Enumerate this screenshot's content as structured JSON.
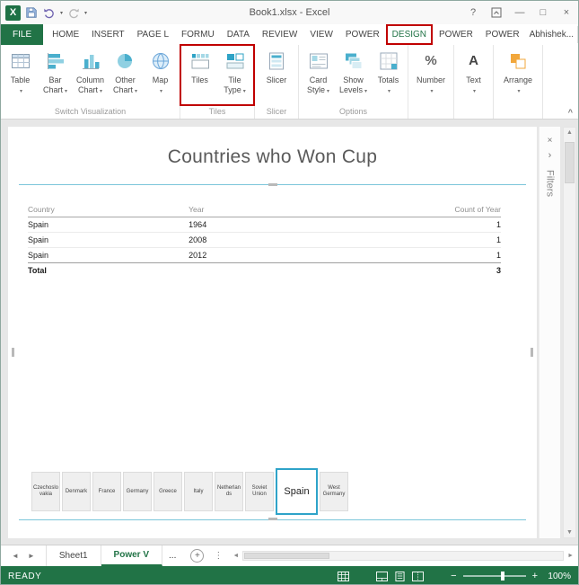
{
  "colors": {
    "excel_green": "#217346",
    "annotation_red": "#c00000",
    "selection_teal": "#7cc6da",
    "tile_selected_border": "#2ea3c9"
  },
  "icons": {
    "excel_logo": "X",
    "dropdown_caret": "▾",
    "help": "?",
    "minimize": "—",
    "maximize": "□",
    "close": "×",
    "filters_chevron": "›",
    "collapse_ribbon": "^",
    "scroll_up": "▲",
    "scroll_down": "▼",
    "scroll_left": "◄",
    "scroll_right": "►",
    "nav_left": "◄",
    "nav_right": "►",
    "new_sheet": "+",
    "tab_menu": "⋮",
    "number_glyph": "%",
    "text_glyph": "A",
    "zoom_minus": "−",
    "zoom_plus": "+"
  },
  "titlebar": {
    "title": "Book1.xlsx - Excel"
  },
  "ribbon": {
    "file_tab": "FILE",
    "tabs": [
      "HOME",
      "INSERT",
      "PAGE L",
      "FORMU",
      "DATA",
      "REVIEW",
      "VIEW",
      "POWER",
      "DESIGN",
      "POWER",
      "POWER"
    ],
    "active_tab": "DESIGN",
    "user_name": "Abhishek...",
    "groups": [
      {
        "label": "Switch Visualization",
        "buttons": [
          {
            "line1": "Table",
            "line2": ""
          },
          {
            "line1": "Bar",
            "line2": "Chart"
          },
          {
            "line1": "Column",
            "line2": "Chart"
          },
          {
            "line1": "Other",
            "line2": "Chart"
          },
          {
            "line1": "Map",
            "line2": ""
          }
        ]
      },
      {
        "label": "Tiles",
        "buttons": [
          {
            "line1": "Tiles",
            "line2": ""
          },
          {
            "line1": "Tile",
            "line2": "Type"
          }
        ]
      },
      {
        "label": "Slicer",
        "buttons": [
          {
            "line1": "Slicer",
            "line2": ""
          }
        ]
      },
      {
        "label": "Options",
        "buttons": [
          {
            "line1": "Card",
            "line2": "Style"
          },
          {
            "line1": "Show",
            "line2": "Levels"
          },
          {
            "line1": "Totals",
            "line2": ""
          }
        ]
      },
      {
        "label": "",
        "buttons": [
          {
            "line1": "Number",
            "line2": ""
          }
        ]
      },
      {
        "label": "",
        "buttons": [
          {
            "line1": "Text",
            "line2": ""
          }
        ]
      },
      {
        "label": "",
        "buttons": [
          {
            "line1": "Arrange",
            "line2": ""
          }
        ]
      }
    ]
  },
  "report": {
    "title": "Countries who Won Cup",
    "table": {
      "headers": [
        "Country",
        "Year",
        "Count of Year"
      ],
      "rows": [
        {
          "country": "Spain",
          "year": "1964",
          "count": "1"
        },
        {
          "country": "Spain",
          "year": "2008",
          "count": "1"
        },
        {
          "country": "Spain",
          "year": "2012",
          "count": "1"
        }
      ],
      "total_label": "Total",
      "total_value": "3"
    },
    "tiles": [
      "Czechoslovakia",
      "Denmark",
      "France",
      "Germany",
      "Greece",
      "Italy",
      "Netherlands",
      "Soviet Union",
      "Spain",
      "West Germany"
    ],
    "selected_tile": "Spain"
  },
  "filters": {
    "title": "Filters"
  },
  "sheets": {
    "tabs": [
      "Sheet1",
      "Power V"
    ],
    "active": "Power V",
    "overflow": "..."
  },
  "status": {
    "mode": "READY",
    "zoom": "100%"
  }
}
